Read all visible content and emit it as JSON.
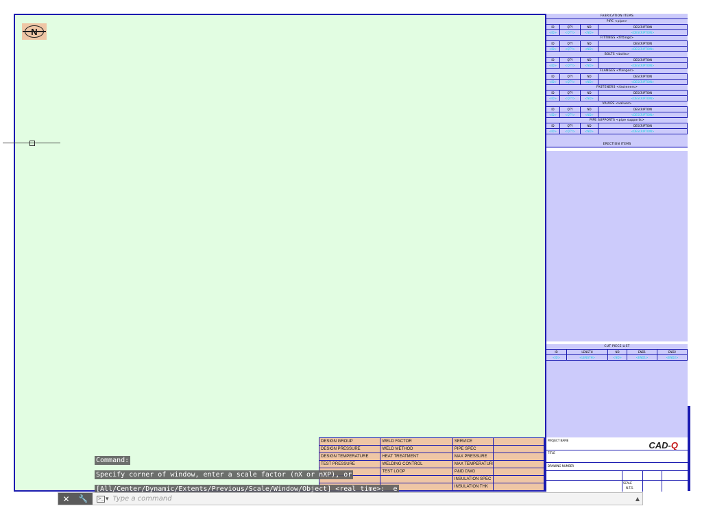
{
  "drawing": {
    "compass_letter": "N",
    "colors": {
      "sheet": "#e2fde2",
      "panel": "#cccbfb",
      "border": "#1b1bb0",
      "process_table": "#efc6a5",
      "data_text": "#17d3e0"
    }
  },
  "bom": {
    "title": "FABRICATION ITEMS",
    "headers": [
      "ID",
      "QTY",
      "ND",
      "DESCRIPTION"
    ],
    "data_row": [
      "<ID>",
      "<QTY>",
      "<ND>",
      "<DESCRIPTION>"
    ],
    "sections": [
      "PIPE <pipe>",
      "FITTINGS <fittings>",
      "BOLTS <bolts>",
      "FLANGES <flanges>",
      "FASTENERS <fasteners>",
      "VALVES <valves>",
      "PIPE SUPPORTS <pipe supports>"
    ],
    "erection_title": "ERECTION ITEMS"
  },
  "cutlist": {
    "title": "CUT PIECE LIST",
    "headers": [
      "ID",
      "LENGTH",
      "ND",
      "END1",
      "END2"
    ],
    "data_row": [
      "<ID>",
      "<LENGTH>",
      "<ND>",
      "<END1>",
      "<END2>"
    ]
  },
  "process_table": {
    "rows": [
      [
        "DESIGN GROUP",
        "WELD FACTOR",
        "SERVICE",
        ""
      ],
      [
        "DESIGN PRESSURE",
        "WELD METHOD",
        "PIPE SPEC",
        ""
      ],
      [
        "DESIGN TEMPERATURE",
        "HEAT TREATMENT",
        "MAX PRESSURE",
        ""
      ],
      [
        "TEST PRESSURE",
        "WELDING CONTROL",
        "MAX TEMPERATURE",
        ""
      ],
      [
        "",
        "TEST LOOP",
        "P&ID DWG",
        ""
      ],
      [
        "",
        "",
        "INSULATION SPEC",
        ""
      ],
      [
        "",
        "",
        "INSULATION THK",
        ""
      ]
    ]
  },
  "titleblock": {
    "logo_main": "CAD-",
    "logo_tail": "Q",
    "labels": {
      "project": "PROJECT NAME",
      "title": "TITLE",
      "drawing_number": "DRAWING NUMBER",
      "scale": "SCALE",
      "scale_value": "N.T.S."
    }
  },
  "command": {
    "history": [
      "Command:",
      "Specify corner of window, enter a scale factor (nX or nXP), or",
      "[All/Center/Dynamic/Extents/Previous/Scale/Window/Object] <real time>: _e"
    ],
    "placeholder": "Type a command",
    "grip_close": "✕",
    "grip_settings": "🔧"
  }
}
